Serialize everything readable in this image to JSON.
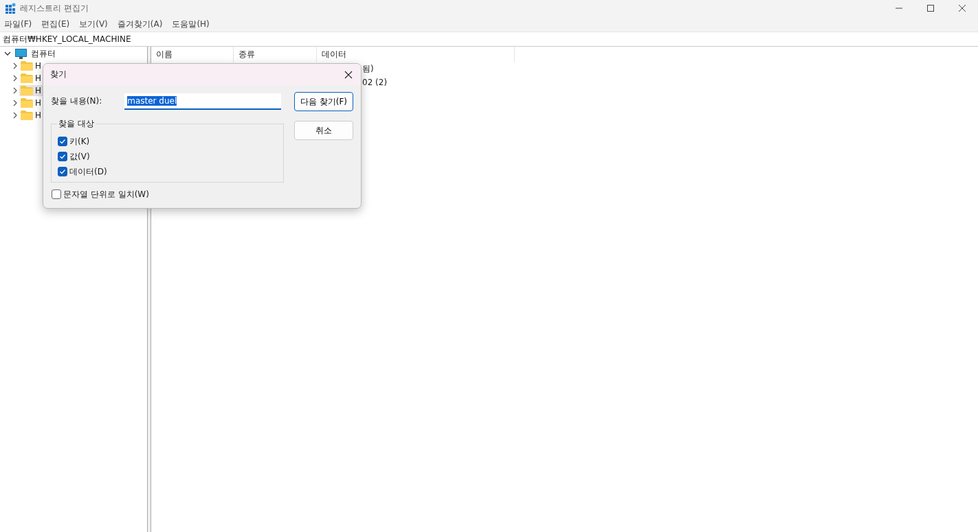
{
  "window": {
    "title": "레지스트리 편집기"
  },
  "menu": [
    "파일(F)",
    "편집(E)",
    "보기(V)",
    "즐겨찾기(A)",
    "도움말(H)"
  ],
  "address": "컴퓨터₩HKEY_LOCAL_MACHINE",
  "tree": {
    "label": "컴퓨터",
    "expanded": true,
    "children": [
      {
        "label": "H",
        "selected": false
      },
      {
        "label": "H",
        "selected": false
      },
      {
        "label": "H",
        "selected": true
      },
      {
        "label": "H",
        "selected": false
      },
      {
        "label": "H",
        "selected": false
      }
    ]
  },
  "table": {
    "columns": [
      "이름",
      "종류",
      "데이터"
    ],
    "rows": [
      {
        "data": "됨)"
      },
      {
        "data": "02 (2)"
      }
    ]
  },
  "dialog": {
    "title": "찾기",
    "find_label": "찾을 내용(N):",
    "find_value": "master duel",
    "find_next": "다음 찾기(F)",
    "cancel": "취소",
    "group_title": "찾을 대상",
    "options": [
      {
        "label": "키(K)",
        "checked": true
      },
      {
        "label": "값(V)",
        "checked": true
      },
      {
        "label": "데이터(D)",
        "checked": true
      }
    ],
    "whole_string": {
      "label": "문자열 단위로 일치(W)",
      "checked": false
    }
  }
}
